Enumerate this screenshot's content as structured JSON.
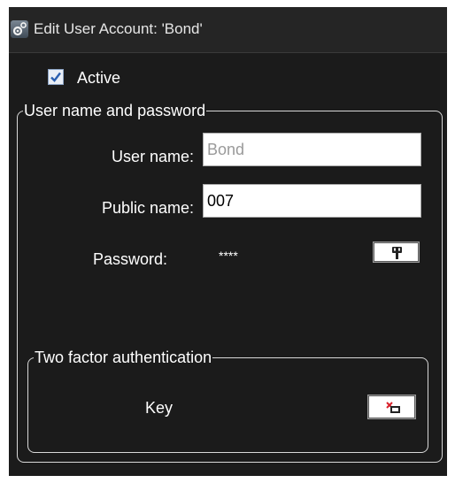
{
  "window": {
    "title": "Edit User Account: 'Bond'",
    "title_icon": "settings-gear-icon"
  },
  "active": {
    "label": "Active",
    "checked": true
  },
  "credentials_group": {
    "legend": "User name and password",
    "user_name": {
      "label": "User name:",
      "value": "Bond",
      "disabled": true
    },
    "public_name": {
      "label": "Public name:",
      "value": "007"
    },
    "password": {
      "label": "Password:",
      "value": "****",
      "button_icon": "key-icon"
    }
  },
  "two_factor_group": {
    "legend": "Two factor authentication",
    "key_label": "Key",
    "key_button_icon": "remove-key-icon"
  }
}
